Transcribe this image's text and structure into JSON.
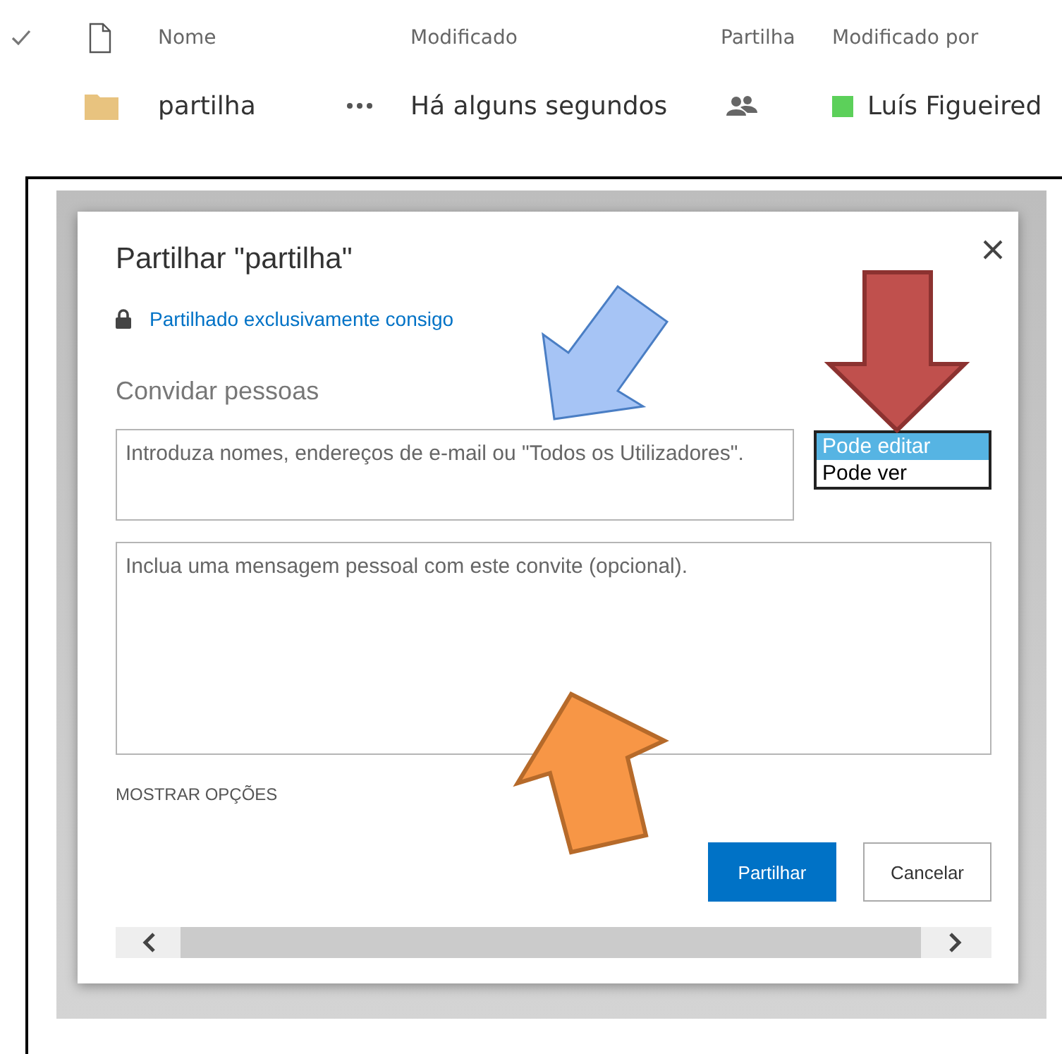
{
  "list": {
    "columns": [
      {
        "label": "Nome"
      },
      {
        "label": "Modificado"
      },
      {
        "label": "Partilha"
      },
      {
        "label": "Modificado por"
      }
    ],
    "rows": [
      {
        "name": "partilha",
        "modified": "Há alguns segundos",
        "modified_by": "Luís Figueired",
        "color": "#5cd05a"
      }
    ]
  },
  "dialog": {
    "title": "Partilhar \"partilha\"",
    "sharing_status": "Partilhado exclusivamente consigo",
    "invite_label": "Convidar pessoas",
    "people_field": {
      "placeholder": "Introduza nomes, endereços de e-mail ou \"Todos os Utilizadores\"."
    },
    "permissions": [
      {
        "label": "Pode editar",
        "selected": true
      },
      {
        "label": "Pode ver",
        "selected": false
      }
    ],
    "message_field": {
      "placeholder": "Inclua uma mensagem pessoal com este convite (opcional)."
    },
    "show_options": "MOSTRAR OPÇÕES",
    "buttons": [
      {
        "label": "Partilhar",
        "kind": "primary"
      },
      {
        "label": "Cancelar",
        "kind": "secondary"
      }
    ]
  }
}
